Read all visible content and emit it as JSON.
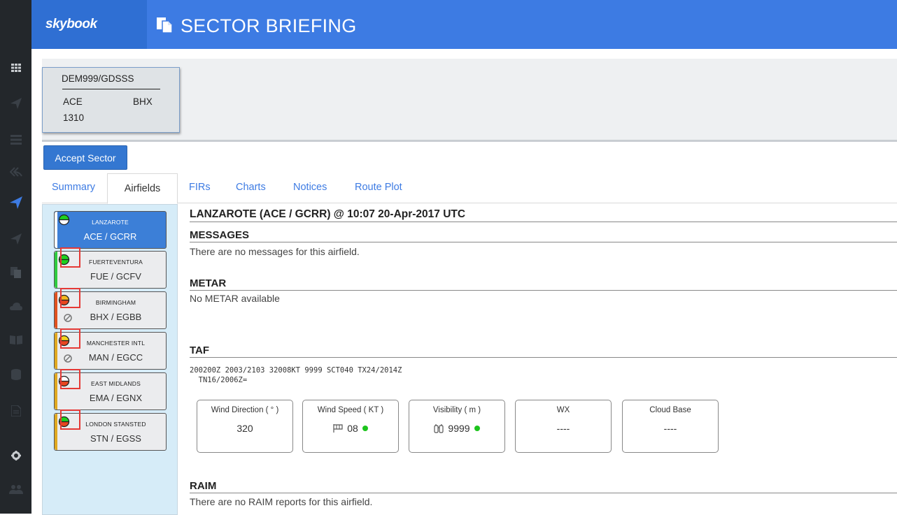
{
  "app": {
    "brand": "skybook",
    "title": "SECTOR BRIEFING"
  },
  "rail": {
    "icons": [
      "grid-icon",
      "plane-icon",
      "list-icon",
      "reply-icon",
      "plane-active-icon",
      "plane-icon",
      "copy-icon",
      "weather-icon",
      "book-icon",
      "database-icon",
      "document-icon",
      "gear-icon",
      "users-icon"
    ]
  },
  "sector": {
    "flight": "DEM999/GDSSS",
    "origin": "ACE",
    "destination": "BHX",
    "time": "1310"
  },
  "accept_label": "Accept Sector",
  "tabs": [
    {
      "label": "Summary"
    },
    {
      "label": "Airfields"
    },
    {
      "label": "FIRs"
    },
    {
      "label": "Charts"
    },
    {
      "label": "Notices"
    },
    {
      "label": "Route Plot"
    }
  ],
  "airfields": [
    {
      "name": "LANZAROTE",
      "code": "ACE / GCRR",
      "status": "white",
      "accent": "#ffffff"
    },
    {
      "name": "FUERTEVENTURA",
      "code": "FUE / GCFV",
      "status": "green",
      "accent": "#2ecc40"
    },
    {
      "name": "BIRMINGHAM",
      "code": "BHX / EGBB",
      "status": "orange",
      "accent": "#e0521f"
    },
    {
      "name": "MANCHESTER INTL",
      "code": "MAN / EGCC",
      "status": "yellow",
      "accent": "#e0a91f"
    },
    {
      "name": "EAST MIDLANDS",
      "code": "EMA / EGNX",
      "status": "white",
      "accent": "#e0a91f"
    },
    {
      "name": "LONDON STANSTED",
      "code": "STN / EGSS",
      "status": "green",
      "accent": "#e0a91f"
    }
  ],
  "detail": {
    "header": "LANZAROTE (ACE / GCRR) @ 10:07 20-Apr-2017 UTC",
    "messages_title": "MESSAGES",
    "messages_text": "There are no messages for this airfield.",
    "metar_title": "METAR",
    "metar_text": "No METAR available",
    "taf_title": "TAF",
    "taf_line1": "200200Z 2003/2103 32008KT 9999 SCT040 TX24/2014Z",
    "taf_line2": "  TN16/2006Z=",
    "wx": [
      {
        "label": "Wind Direction ( ° )",
        "value": "320"
      },
      {
        "label": "Wind Speed ( KT )",
        "value": "08"
      },
      {
        "label": "Visibility ( m )",
        "value": "9999"
      },
      {
        "label": "WX",
        "value": "----"
      },
      {
        "label": "Cloud Base",
        "value": "----"
      }
    ],
    "raim_title": "RAIM",
    "raim_text": "There are no RAIM reports for this airfield."
  },
  "colors": {
    "brand": "#2f6fd3",
    "titlebar": "#3d7be3",
    "rail": "#23272b",
    "panel": "#d6ecf8",
    "good": "#1dc41d"
  }
}
